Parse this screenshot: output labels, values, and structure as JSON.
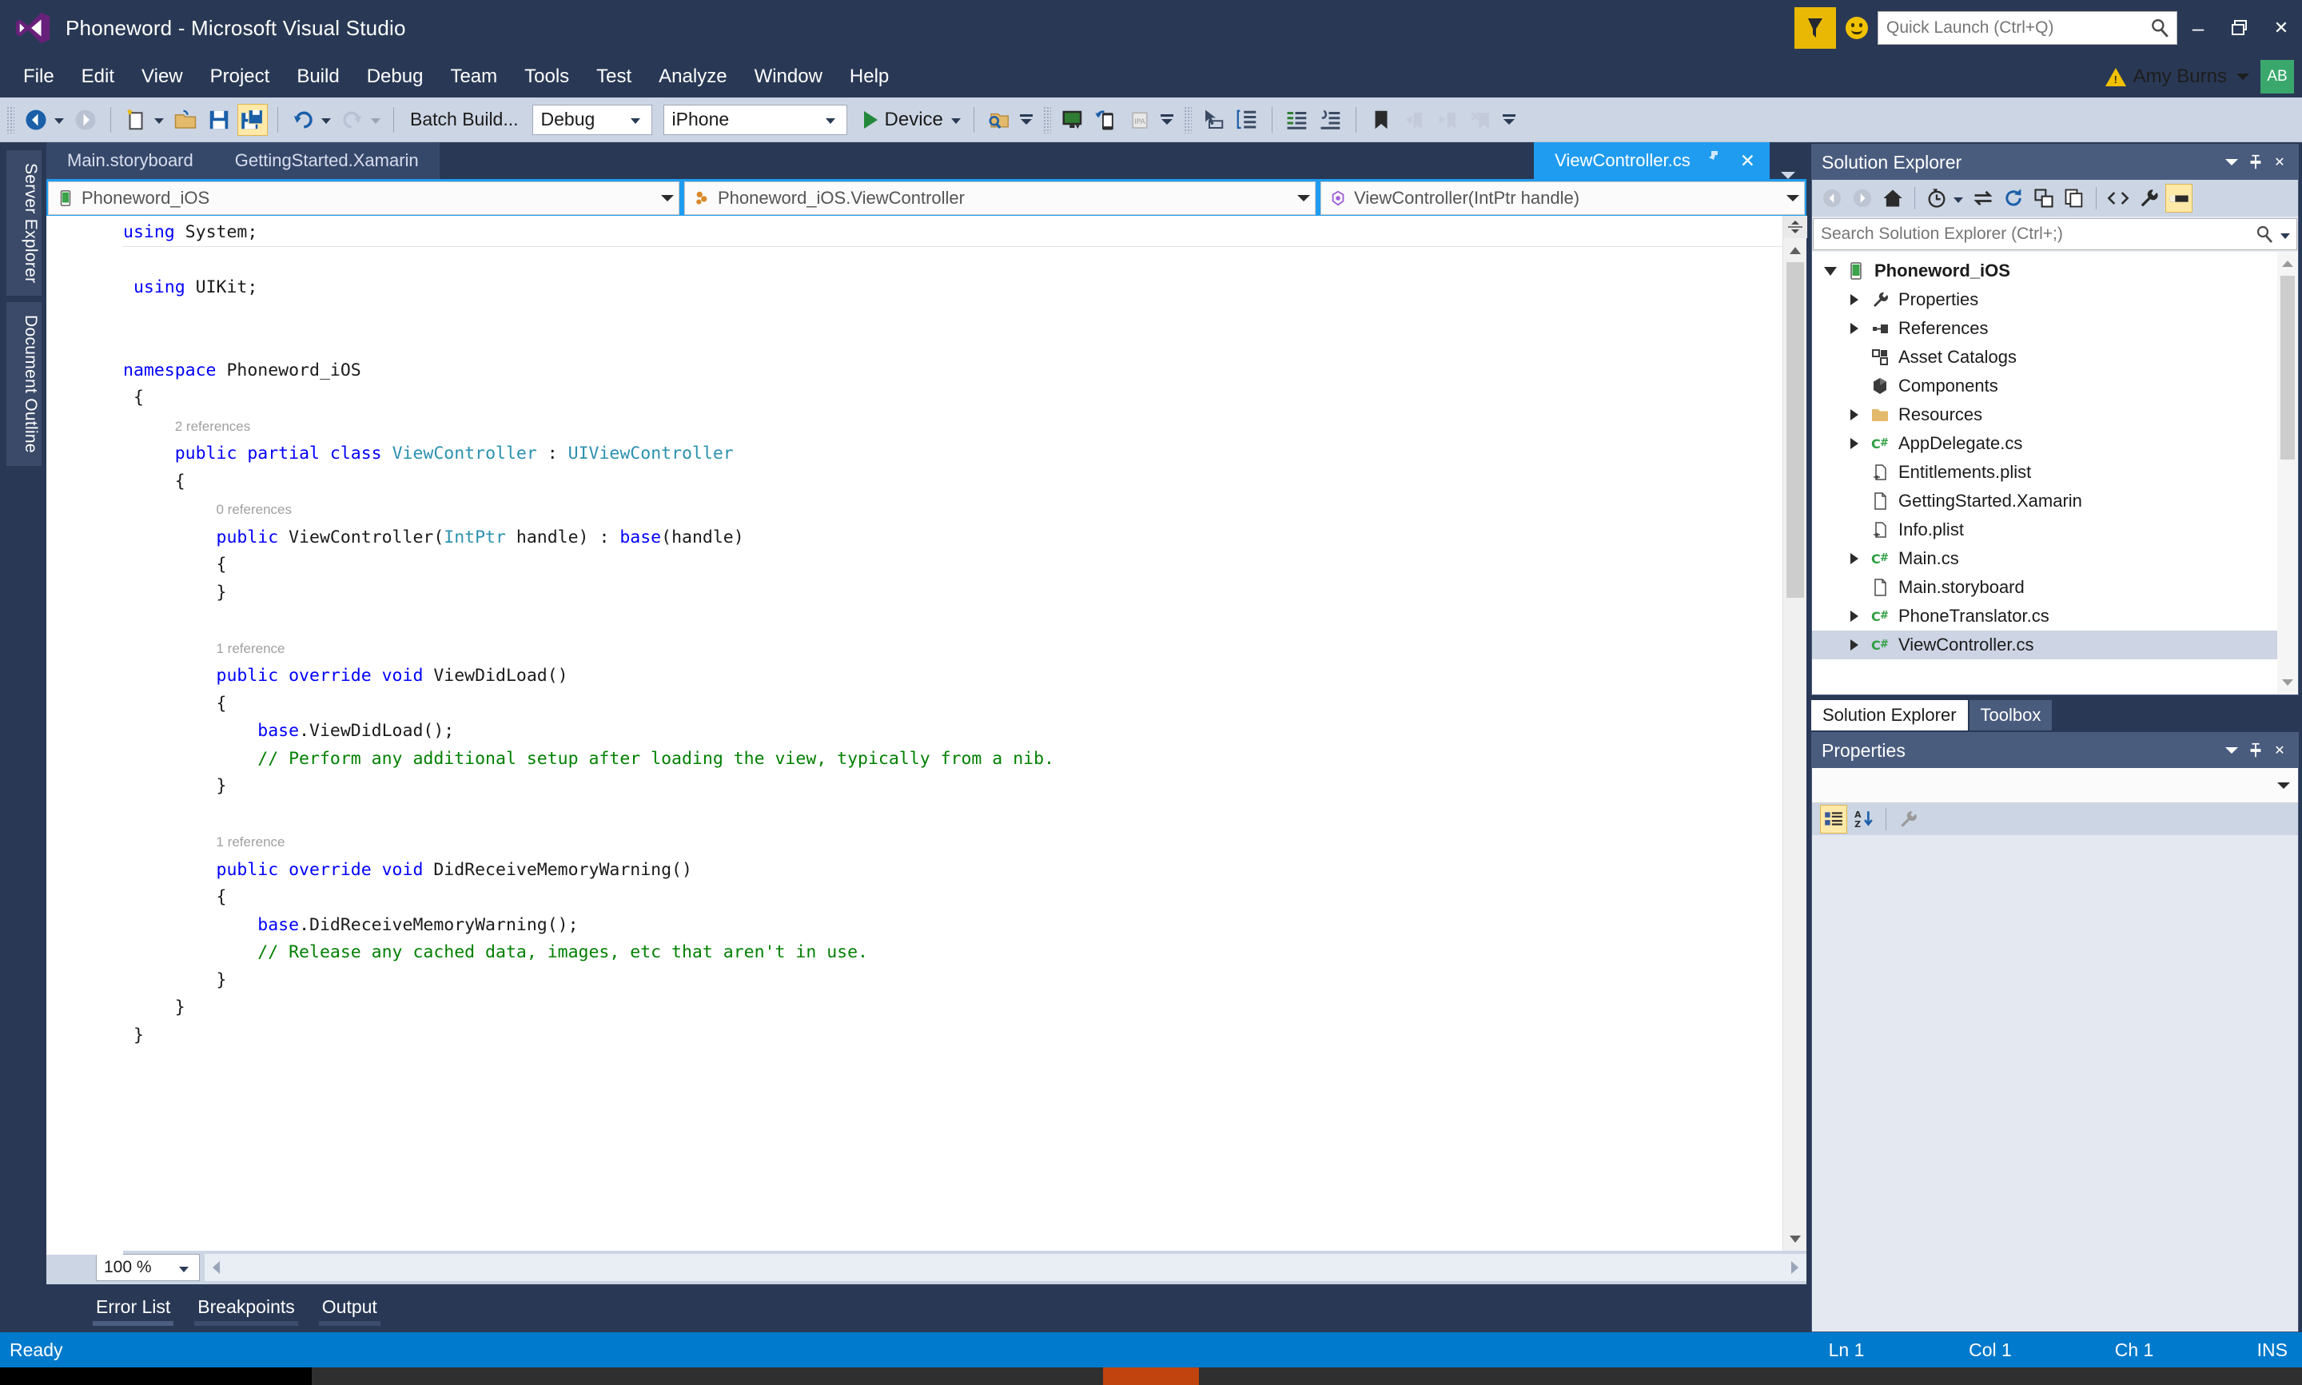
{
  "window": {
    "title": "Phoneword - Microsoft Visual Studio",
    "logo_icon": "visual-studio-logo",
    "minimize_label": "–",
    "restore_label": "❐",
    "close_label": "✕"
  },
  "titlebar": {
    "feedback_icon": "feedback-flag-icon",
    "smiley_icon": "send-a-smile-icon",
    "quick_launch_placeholder": "Quick Launch (Ctrl+Q)",
    "quick_launch_value": "",
    "search_icon": "search-icon",
    "user_name": "Amy Burns",
    "user_warning_icon": "warning-triangle-icon",
    "user_caret_icon": "chevron-down-icon",
    "avatar_initials": "AB"
  },
  "menu": {
    "items": [
      "File",
      "Edit",
      "View",
      "Project",
      "Build",
      "Debug",
      "Team",
      "Tools",
      "Test",
      "Analyze",
      "Window",
      "Help"
    ]
  },
  "toolbar": {
    "nav_back_icon": "navigate-backward-icon",
    "nav_forward_icon": "navigate-forward-icon",
    "new_project_icon": "new-project-icon",
    "open_file_icon": "open-file-icon",
    "save_icon": "save-icon",
    "save_all_icon": "save-all-icon",
    "undo_icon": "undo-icon",
    "redo_icon": "redo-icon",
    "batch_build_label": "Batch Build...",
    "configuration_value": "Debug",
    "platform_value": "iPhone",
    "start_icon": "start-play-icon",
    "start_label": "Device",
    "find_in_files_icon": "find-in-files-icon",
    "android_emulator_icon": "android-emulator-manager-icon",
    "device_sync_icon": "device-sync-icon",
    "ipa_icon": "ipa-package-icon",
    "pointer_icon": "pointer-select-icon",
    "hierarchy_icon": "hierarchy-icon",
    "comment_icon": "comment-lines-icon",
    "uncomment_icon": "uncomment-lines-icon",
    "bookmark_icon": "bookmark-icon",
    "prev_bookmark_icon": "previous-bookmark-icon",
    "next_bookmark_icon": "next-bookmark-icon",
    "clear_bookmarks_icon": "clear-bookmarks-icon",
    "overflow_icon": "toolbar-overflow-icon"
  },
  "left_rail": {
    "tabs": [
      "Server Explorer",
      "Document Outline"
    ]
  },
  "editor": {
    "tabs": [
      {
        "label": "Main.storyboard",
        "active": false
      },
      {
        "label": "GettingStarted.Xamarin",
        "active": false
      },
      {
        "label": "ViewController.cs",
        "active": true
      }
    ],
    "tab_pin_icon": "pin-icon",
    "tab_close_icon": "close-icon",
    "tab_list_icon": "chevron-down-icon",
    "navbar": {
      "project": "Phoneword_iOS",
      "project_icon": "ios-project-icon",
      "type": "Phoneword_iOS.ViewController",
      "type_icon": "class-icon",
      "member": "ViewController(IntPtr handle)",
      "member_icon": "method-icon"
    },
    "zoom_level": "100 %",
    "code_lines": [
      {
        "indent": 0,
        "segments": [
          {
            "t": "using",
            "c": "k"
          },
          {
            "t": " System;",
            "c": ""
          }
        ]
      },
      {
        "indent": 0,
        "segments": []
      },
      {
        "indent": 0,
        "segments": [
          {
            "t": "using",
            "c": "k"
          },
          {
            "t": " UIKit;",
            "c": ""
          }
        ]
      },
      {
        "indent": 0,
        "segments": []
      },
      {
        "indent": 0,
        "segments": []
      },
      {
        "indent": 0,
        "segments": [
          {
            "t": "namespace",
            "c": "k"
          },
          {
            "t": " Phoneword_iOS",
            "c": ""
          }
        ]
      },
      {
        "indent": 0,
        "segments": [
          {
            "t": "{",
            "c": ""
          }
        ]
      },
      {
        "indent": 1,
        "ref": "2 references",
        "segments": []
      },
      {
        "indent": 1,
        "segments": [
          {
            "t": "public partial class",
            "c": "k"
          },
          {
            "t": " ",
            "c": ""
          },
          {
            "t": "ViewController",
            "c": "t"
          },
          {
            "t": " : ",
            "c": ""
          },
          {
            "t": "UIViewController",
            "c": "t"
          }
        ]
      },
      {
        "indent": 1,
        "segments": [
          {
            "t": "{",
            "c": ""
          }
        ]
      },
      {
        "indent": 2,
        "ref": "0 references",
        "segments": []
      },
      {
        "indent": 2,
        "segments": [
          {
            "t": "public",
            "c": "k"
          },
          {
            "t": " ViewController(",
            "c": ""
          },
          {
            "t": "IntPtr",
            "c": "t"
          },
          {
            "t": " handle) : ",
            "c": ""
          },
          {
            "t": "base",
            "c": "k"
          },
          {
            "t": "(handle)",
            "c": ""
          }
        ]
      },
      {
        "indent": 2,
        "segments": [
          {
            "t": "{",
            "c": ""
          }
        ]
      },
      {
        "indent": 2,
        "segments": [
          {
            "t": "}",
            "c": ""
          }
        ]
      },
      {
        "indent": 0,
        "segments": []
      },
      {
        "indent": 2,
        "ref": "1 reference",
        "segments": []
      },
      {
        "indent": 2,
        "segments": [
          {
            "t": "public override void",
            "c": "k"
          },
          {
            "t": " ViewDidLoad()",
            "c": ""
          }
        ]
      },
      {
        "indent": 2,
        "segments": [
          {
            "t": "{",
            "c": ""
          }
        ]
      },
      {
        "indent": 3,
        "segments": [
          {
            "t": "base",
            "c": "k"
          },
          {
            "t": ".ViewDidLoad();",
            "c": ""
          }
        ]
      },
      {
        "indent": 3,
        "segments": [
          {
            "t": "// Perform any additional setup after loading the view, typically from a nib.",
            "c": "c"
          }
        ]
      },
      {
        "indent": 2,
        "segments": [
          {
            "t": "}",
            "c": ""
          }
        ]
      },
      {
        "indent": 0,
        "segments": []
      },
      {
        "indent": 2,
        "ref": "1 reference",
        "segments": []
      },
      {
        "indent": 2,
        "segments": [
          {
            "t": "public override void",
            "c": "k"
          },
          {
            "t": " DidReceiveMemoryWarning()",
            "c": ""
          }
        ]
      },
      {
        "indent": 2,
        "segments": [
          {
            "t": "{",
            "c": ""
          }
        ]
      },
      {
        "indent": 3,
        "segments": [
          {
            "t": "base",
            "c": "k"
          },
          {
            "t": ".DidReceiveMemoryWarning();",
            "c": ""
          }
        ]
      },
      {
        "indent": 3,
        "segments": [
          {
            "t": "// Release any cached data, images, etc that aren't in use.",
            "c": "c"
          }
        ]
      },
      {
        "indent": 2,
        "segments": [
          {
            "t": "}",
            "c": ""
          }
        ]
      },
      {
        "indent": 1,
        "segments": [
          {
            "t": "}",
            "c": ""
          }
        ]
      },
      {
        "indent": 0,
        "segments": [
          {
            "t": "}",
            "c": ""
          }
        ]
      }
    ],
    "code_text": "using System;\n\nusing UIKit;\n\n\nnamespace Phoneword_iOS\n{\n    2 references\n    public partial class ViewController : UIViewController\n    {\n        0 references\n        public ViewController(IntPtr handle) : base(handle)\n        {\n        }\n\n        1 reference\n        public override void ViewDidLoad()\n        {\n            base.ViewDidLoad();\n            // Perform any additional setup after loading the view, typically from a nib.\n        }\n\n        1 reference\n        public override void DidReceiveMemoryWarning()\n        {\n            base.DidReceiveMemoryWarning();\n            // Release any cached data, images, etc that aren't in use.\n        }\n    }\n}"
  },
  "bottom_panel": {
    "tabs": [
      "Error List",
      "Breakpoints",
      "Output"
    ]
  },
  "solution_explorer": {
    "title": "Solution Explorer",
    "dropdown_icon": "chevron-down-icon",
    "pin_icon": "pin-icon",
    "close_icon": "close-icon",
    "toolbar_icons": [
      "back-icon",
      "forward-icon",
      "home-icon",
      "pending-changes-icon",
      "sync-with-active-document-icon",
      "refresh-icon",
      "collapse-all-icon",
      "show-all-files-icon",
      "view-code-icon",
      "properties-wrench-icon",
      "preview-selected-items-icon"
    ],
    "search_placeholder": "Search Solution Explorer (Ctrl+;)",
    "search_value": "",
    "search_icon": "search-icon",
    "tree": [
      {
        "label": "Phoneword_iOS",
        "depth": 0,
        "expander": "down",
        "icon": "ios-project-icon",
        "bold": true,
        "selected": false
      },
      {
        "label": "Properties",
        "depth": 1,
        "expander": "right",
        "icon": "properties-wrench-icon",
        "bold": false,
        "selected": false
      },
      {
        "label": "References",
        "depth": 1,
        "expander": "right",
        "icon": "references-icon",
        "bold": false,
        "selected": false
      },
      {
        "label": "Asset Catalogs",
        "depth": 1,
        "expander": "none",
        "icon": "asset-catalog-icon",
        "bold": false,
        "selected": false
      },
      {
        "label": "Components",
        "depth": 1,
        "expander": "none",
        "icon": "components-icon",
        "bold": false,
        "selected": false
      },
      {
        "label": "Resources",
        "depth": 1,
        "expander": "right",
        "icon": "folder-icon",
        "bold": false,
        "selected": false
      },
      {
        "label": "AppDelegate.cs",
        "depth": 1,
        "expander": "right",
        "icon": "csharp-file-icon",
        "bold": false,
        "selected": false
      },
      {
        "label": "Entitlements.plist",
        "depth": 1,
        "expander": "none",
        "icon": "plist-file-icon",
        "bold": false,
        "selected": false
      },
      {
        "label": "GettingStarted.Xamarin",
        "depth": 1,
        "expander": "none",
        "icon": "document-icon",
        "bold": false,
        "selected": false
      },
      {
        "label": "Info.plist",
        "depth": 1,
        "expander": "none",
        "icon": "plist-file-icon",
        "bold": false,
        "selected": false
      },
      {
        "label": "Main.cs",
        "depth": 1,
        "expander": "right",
        "icon": "csharp-file-icon",
        "bold": false,
        "selected": false
      },
      {
        "label": "Main.storyboard",
        "depth": 1,
        "expander": "none",
        "icon": "document-icon",
        "bold": false,
        "selected": false
      },
      {
        "label": "PhoneTranslator.cs",
        "depth": 1,
        "expander": "right",
        "icon": "csharp-file-icon",
        "bold": false,
        "selected": false
      },
      {
        "label": "ViewController.cs",
        "depth": 1,
        "expander": "right",
        "icon": "csharp-file-icon",
        "bold": false,
        "selected": true
      }
    ],
    "dock_tabs": [
      {
        "label": "Solution Explorer",
        "active": true
      },
      {
        "label": "Toolbox",
        "active": false
      }
    ]
  },
  "properties": {
    "title": "Properties",
    "dropdown_icon": "chevron-down-icon",
    "pin_icon": "pin-icon",
    "close_icon": "close-icon",
    "object_value": "",
    "object_caret_icon": "chevron-down-icon",
    "categorized_icon": "categorized-view-icon",
    "alphabetical_icon": "alphabetical-sort-icon",
    "property_pages_icon": "property-pages-wrench-icon"
  },
  "statusbar": {
    "status": "Ready",
    "line": "Ln 1",
    "column": "Col 1",
    "character": "Ch 1",
    "insert_mode": "INS"
  },
  "colors": {
    "accent_blue": "#007acc",
    "chrome_dark": "#293955",
    "panel_header": "#4a5c7e",
    "toolbar_bg": "#ccd5e4",
    "active_tab": "#1f9cf0",
    "keyword": "#0000ff",
    "type": "#2b91af",
    "comment": "#008000",
    "avatar_green": "#3aa86d",
    "flag_yellow": "#e8b805"
  }
}
